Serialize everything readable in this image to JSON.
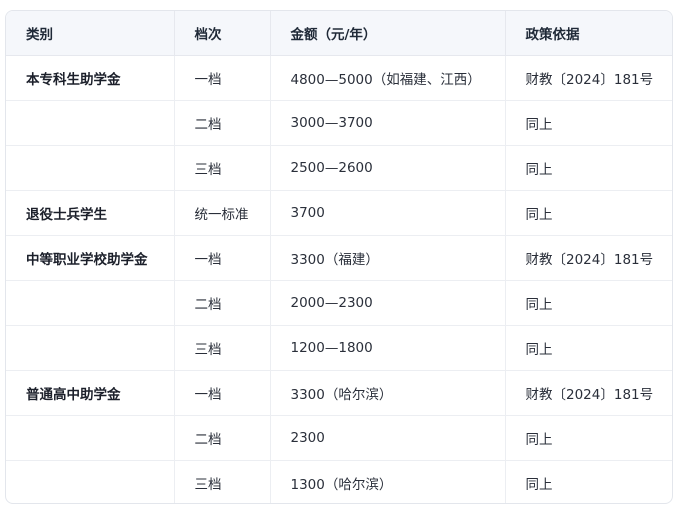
{
  "table": {
    "headers": [
      "类别",
      "档次",
      "金额（元/年）",
      "政策依据"
    ],
    "rows": [
      {
        "category": "本专科生助学金",
        "tier": "一档",
        "amount": "4800—5000（如福建、江西）",
        "policy": "财教〔2024〕181号"
      },
      {
        "category": "",
        "tier": "二档",
        "amount": "3000—3700",
        "policy": "同上"
      },
      {
        "category": "",
        "tier": "三档",
        "amount": "2500—2600",
        "policy": "同上"
      },
      {
        "category": "退役士兵学生",
        "tier": "统一标准",
        "amount": "3700",
        "policy": "同上"
      },
      {
        "category": "中等职业学校助学金",
        "tier": "一档",
        "amount": "3300（福建）",
        "policy": "财教〔2024〕181号"
      },
      {
        "category": "",
        "tier": "二档",
        "amount": "2000—2300",
        "policy": "同上"
      },
      {
        "category": "",
        "tier": "三档",
        "amount": "1200—1800",
        "policy": "同上"
      },
      {
        "category": "普通高中助学金",
        "tier": "一档",
        "amount": "3300（哈尔滨）",
        "policy": "财教〔2024〕181号"
      },
      {
        "category": "",
        "tier": "二档",
        "amount": "2300",
        "policy": "同上"
      },
      {
        "category": "",
        "tier": "三档",
        "amount": "1300（哈尔滨）",
        "policy": "同上"
      }
    ]
  }
}
